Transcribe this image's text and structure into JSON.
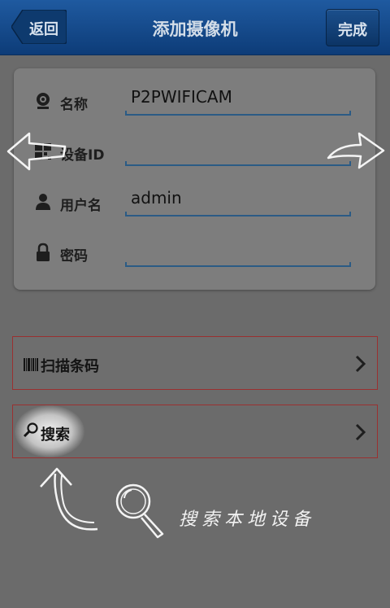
{
  "header": {
    "back_label": "返回",
    "title": "添加摄像机",
    "done_label": "完成"
  },
  "form": {
    "name": {
      "label": "名称",
      "value": "P2PWIFICAM",
      "icon": "camera-icon"
    },
    "device_id": {
      "label": "设备ID",
      "value": "",
      "icon": "qr-icon"
    },
    "username": {
      "label": "用户名",
      "value": "admin",
      "icon": "user-icon"
    },
    "password": {
      "label": "密码",
      "value": "",
      "icon": "lock-icon"
    }
  },
  "actions": {
    "scan_label": "扫描条码",
    "search_label": "搜索"
  },
  "overlay": {
    "hint": "搜索本地设备"
  },
  "colors": {
    "header_bg": "#0d3c78",
    "field_underline": "#2b5b85",
    "item_border": "#9a3030"
  }
}
